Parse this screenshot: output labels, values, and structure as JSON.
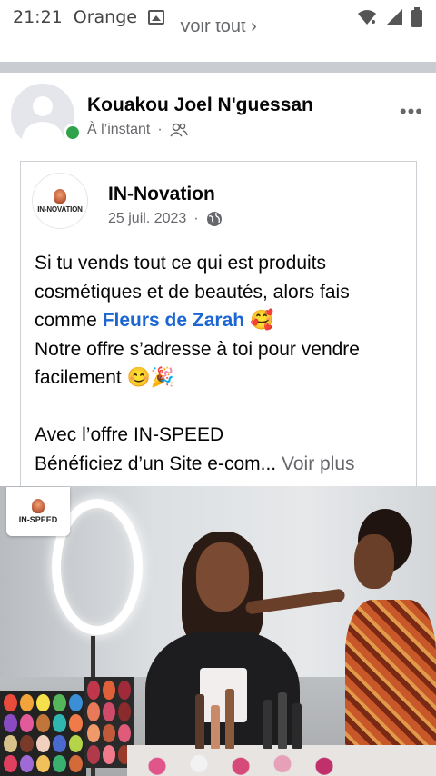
{
  "status_bar": {
    "time": "21:21",
    "carrier": "Orange"
  },
  "previous_section": {
    "link_label": "Voir tout"
  },
  "post": {
    "author": "Kouakou Joel N'guessan",
    "timestamp": "À l’instant",
    "audience_icon": "friends-icon",
    "online": true
  },
  "shared_post": {
    "page_name": "IN-Novation",
    "page_logo_text": "IN-NOVATION",
    "date": "25 juil. 2023",
    "audience_icon": "globe-icon",
    "text_lines": [
      "Si tu vends tout ce qui est produits",
      "cosmétiques et de beautés, alors fais",
      "comme",
      "Notre offre s’adresse à toi pour vendre",
      "facilement 😊🎉",
      "Avec l’offre IN-SPEED",
      "Bénéficiez d’un Site e-com"
    ],
    "tagged_page": "Fleurs de Zarah",
    "tag_emoji": "🥰",
    "ellipsis": "...",
    "see_more": "Voir plus",
    "image_badge_text": "IN-SPEED"
  },
  "colors": {
    "link_blue": "#1b66d2",
    "online_green": "#31a24c",
    "secondary_text": "#65676b"
  }
}
